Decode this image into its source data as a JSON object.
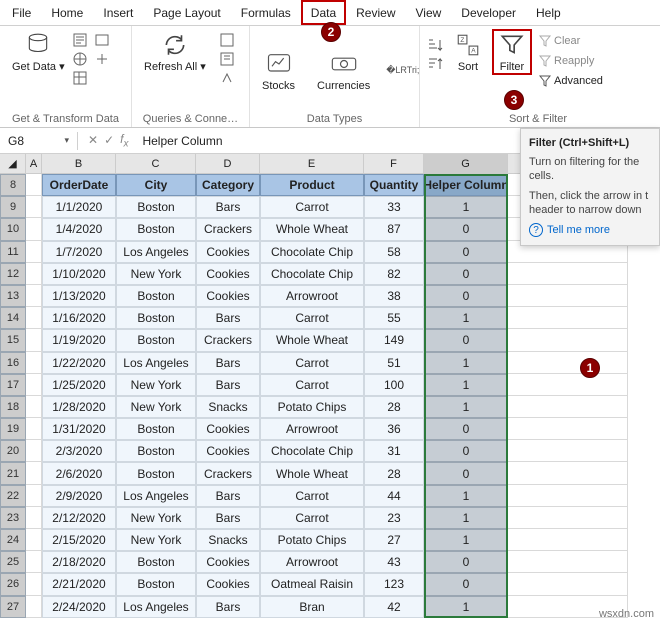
{
  "menu": {
    "items": [
      "File",
      "Home",
      "Insert",
      "Page Layout",
      "Formulas",
      "Data",
      "Review",
      "View",
      "Developer",
      "Help"
    ],
    "active": 5
  },
  "ribbon": {
    "getdata": {
      "label": "Get & Transform Data",
      "main": "Get\nData ▾"
    },
    "queries": {
      "label": "Queries & Conne…",
      "main": "Refresh\nAll ▾"
    },
    "datatypes": {
      "label": "Data Types",
      "stocks": "Stocks",
      "curr": "Currencies"
    },
    "sortfilter": {
      "label": "Sort & Filter",
      "sort": "Sort",
      "filter": "Filter",
      "clear": "Clear",
      "reapply": "Reapply",
      "advanced": "Advanced"
    }
  },
  "namebox": "G8",
  "formula": "Helper Column",
  "cols": [
    "A",
    "B",
    "C",
    "D",
    "E",
    "F",
    "G"
  ],
  "headers": [
    "OrderDate",
    "City",
    "Category",
    "Product",
    "Quantity",
    "Helper Column"
  ],
  "rows": [
    {
      "n": 9,
      "d": [
        "1/1/2020",
        "Boston",
        "Bars",
        "Carrot",
        "33",
        "1"
      ]
    },
    {
      "n": 10,
      "d": [
        "1/4/2020",
        "Boston",
        "Crackers",
        "Whole Wheat",
        "87",
        "0"
      ]
    },
    {
      "n": 11,
      "d": [
        "1/7/2020",
        "Los Angeles",
        "Cookies",
        "Chocolate Chip",
        "58",
        "0"
      ]
    },
    {
      "n": 12,
      "d": [
        "1/10/2020",
        "New York",
        "Cookies",
        "Chocolate Chip",
        "82",
        "0"
      ]
    },
    {
      "n": 13,
      "d": [
        "1/13/2020",
        "Boston",
        "Cookies",
        "Arrowroot",
        "38",
        "0"
      ]
    },
    {
      "n": 14,
      "d": [
        "1/16/2020",
        "Boston",
        "Bars",
        "Carrot",
        "55",
        "1"
      ]
    },
    {
      "n": 15,
      "d": [
        "1/19/2020",
        "Boston",
        "Crackers",
        "Whole Wheat",
        "149",
        "0"
      ]
    },
    {
      "n": 16,
      "d": [
        "1/22/2020",
        "Los Angeles",
        "Bars",
        "Carrot",
        "51",
        "1"
      ]
    },
    {
      "n": 17,
      "d": [
        "1/25/2020",
        "New York",
        "Bars",
        "Carrot",
        "100",
        "1"
      ]
    },
    {
      "n": 18,
      "d": [
        "1/28/2020",
        "New York",
        "Snacks",
        "Potato Chips",
        "28",
        "1"
      ]
    },
    {
      "n": 19,
      "d": [
        "1/31/2020",
        "Boston",
        "Cookies",
        "Arrowroot",
        "36",
        "0"
      ]
    },
    {
      "n": 20,
      "d": [
        "2/3/2020",
        "Boston",
        "Cookies",
        "Chocolate Chip",
        "31",
        "0"
      ]
    },
    {
      "n": 21,
      "d": [
        "2/6/2020",
        "Boston",
        "Crackers",
        "Whole Wheat",
        "28",
        "0"
      ]
    },
    {
      "n": 22,
      "d": [
        "2/9/2020",
        "Los Angeles",
        "Bars",
        "Carrot",
        "44",
        "1"
      ]
    },
    {
      "n": 23,
      "d": [
        "2/12/2020",
        "New York",
        "Bars",
        "Carrot",
        "23",
        "1"
      ]
    },
    {
      "n": 24,
      "d": [
        "2/15/2020",
        "New York",
        "Snacks",
        "Potato Chips",
        "27",
        "1"
      ]
    },
    {
      "n": 25,
      "d": [
        "2/18/2020",
        "Boston",
        "Cookies",
        "Arrowroot",
        "43",
        "0"
      ]
    },
    {
      "n": 26,
      "d": [
        "2/21/2020",
        "Boston",
        "Cookies",
        "Oatmeal Raisin",
        "123",
        "0"
      ]
    },
    {
      "n": 27,
      "d": [
        "2/24/2020",
        "Los Angeles",
        "Bars",
        "Bran",
        "42",
        "1"
      ]
    }
  ],
  "tooltip": {
    "title": "Filter (Ctrl+Shift+L)",
    "body1": "Turn on filtering for the cells.",
    "body2": "Then, click the arrow in t header to narrow down",
    "link": "Tell me more"
  },
  "watermark": "wsxdn.com"
}
